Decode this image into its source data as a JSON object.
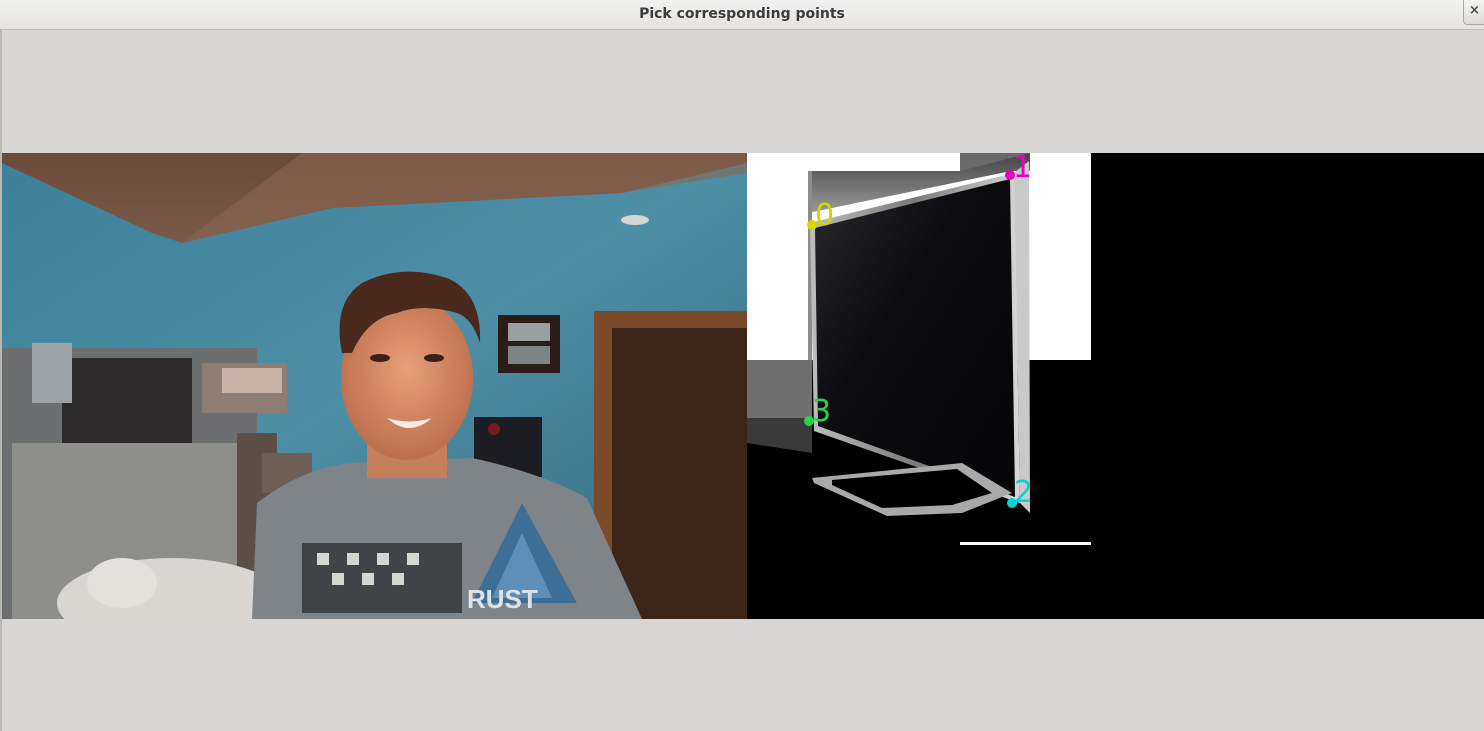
{
  "window": {
    "title": "Pick corresponding points",
    "close_glyph": "×"
  },
  "points": [
    {
      "label": "0",
      "color": "#d6d600"
    },
    {
      "label": "1",
      "color": "#e600c8"
    },
    {
      "label": "2",
      "color": "#00d6d6"
    },
    {
      "label": "3",
      "color": "#1fd64a"
    }
  ]
}
